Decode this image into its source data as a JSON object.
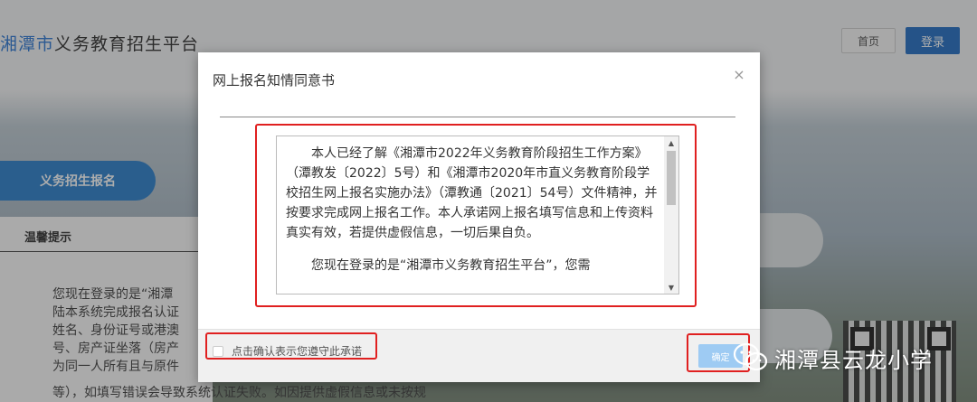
{
  "header": {
    "brand_highlight": "湘潭市",
    "brand_rest": "义务教育招生平台",
    "home_label": "首页",
    "login_label": "登录"
  },
  "nav": {
    "tab_label": "义务招生报名"
  },
  "tips": {
    "title": "温馨提示",
    "body": "您现在登录的是“湘潭\n陆本系统完成报名认证\n姓名、身份证号或港澳\n号、房产证坐落（房产\n为同一人所有且与原件",
    "bottom": "等），如填写错误会导致系统认证失败。如因提供虚假信息或未按规"
  },
  "modal": {
    "title": "网上报名知情同意书",
    "close_symbol": "×",
    "paragraphs": [
      "本人已经了解《湘潭市2022年义务教育阶段招生工作方案》（潭教发〔2022〕5号）和《湘潭市2020年市直义务教育阶段学校招生网上报名实施办法》（潭教通〔2021〕54号）文件精神，并按要求完成网上报名工作。本人承诺网上报名填写信息和上传资料真实有效，若提供虚假信息，一切后果自负。",
      "您现在登录的是“湘潭市义务教育招生平台”，您需"
    ],
    "checkbox_label": "点击确认表示您遵守此承诺",
    "checked": false,
    "confirm_label": "确定"
  },
  "watermark": {
    "text": "湘潭县云龙小学"
  },
  "colors": {
    "brand_blue": "#1f6fd0",
    "primary": "#1565c0",
    "highlight_red": "#e02020",
    "confirm_disabled": "#9ecbf3"
  }
}
